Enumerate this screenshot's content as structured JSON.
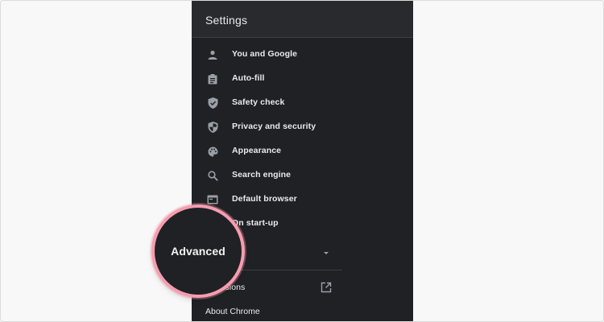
{
  "settings": {
    "title": "Settings",
    "items": [
      {
        "label": "You and Google",
        "icon": "person-icon"
      },
      {
        "label": "Auto-fill",
        "icon": "clipboard-icon"
      },
      {
        "label": "Safety check",
        "icon": "shield-check-icon"
      },
      {
        "label": "Privacy and security",
        "icon": "shield-half-icon"
      },
      {
        "label": "Appearance",
        "icon": "palette-icon"
      },
      {
        "label": "Search engine",
        "icon": "search-icon"
      },
      {
        "label": "Default browser",
        "icon": "browser-window-icon"
      },
      {
        "label": "On start-up",
        "icon": "power-icon"
      }
    ],
    "advanced_label": "Advanced",
    "extensions_label": "ensions",
    "about_label": "About Chrome"
  },
  "magnifier": {
    "label": "Advanced",
    "ring_color": "#f59db0"
  },
  "colors": {
    "panel_bg": "#202124",
    "header_bg": "#292a2d",
    "text": "#e8eaed",
    "icon": "#9aa0a6"
  }
}
